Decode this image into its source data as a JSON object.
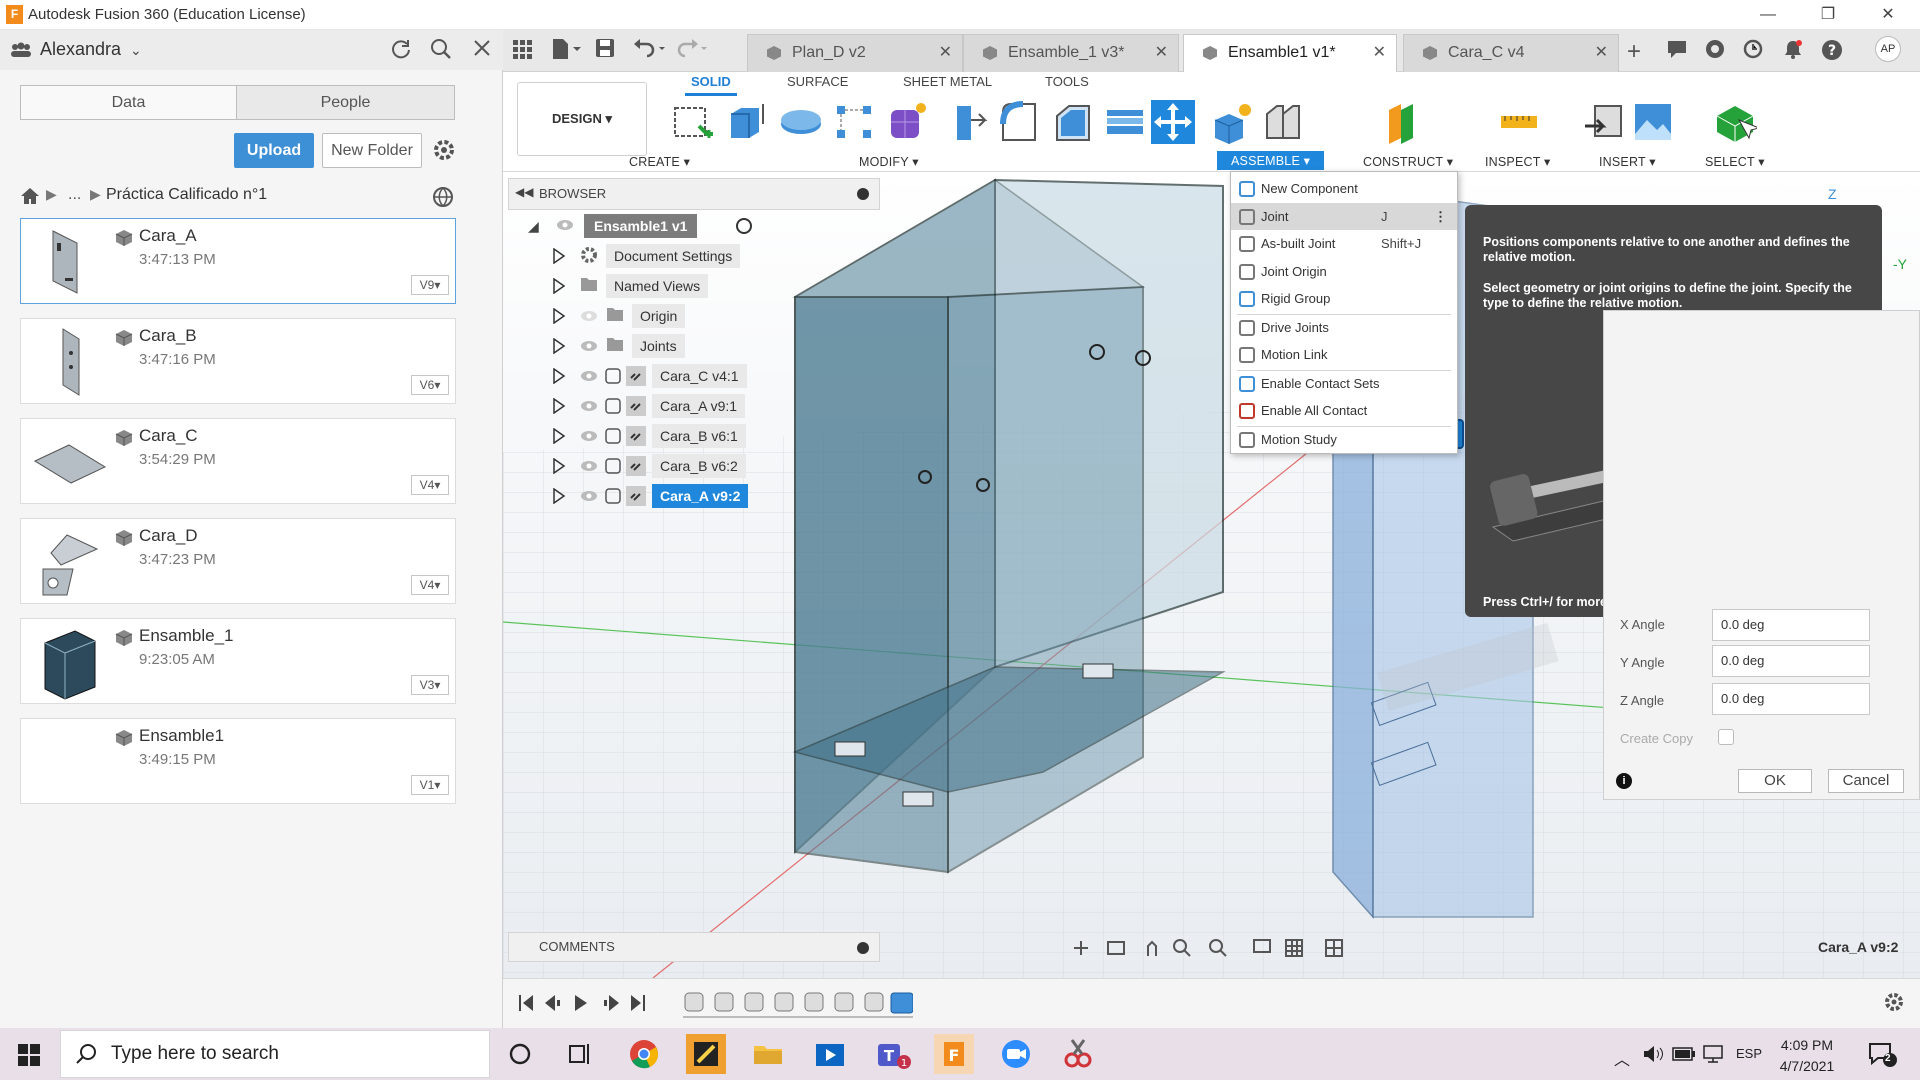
{
  "window": {
    "title": "Autodesk Fusion 360 (Education License)",
    "min": "—",
    "restore": "❐",
    "close": "✕"
  },
  "data_panel": {
    "user": "Alexandra",
    "tabs": [
      "Data",
      "People"
    ],
    "upload": "Upload",
    "new_folder": "New Folder",
    "breadcrumb_ellipsis": "...",
    "breadcrumb": "Práctica Calificado n°1",
    "files": [
      {
        "name": "Cara_A",
        "time": "3:47:13 PM",
        "version": "V9"
      },
      {
        "name": "Cara_B",
        "time": "3:47:16 PM",
        "version": "V6"
      },
      {
        "name": "Cara_C",
        "time": "3:54:29 PM",
        "version": "V4"
      },
      {
        "name": "Cara_D",
        "time": "3:47:23 PM",
        "version": "V4"
      },
      {
        "name": "Ensamble_1",
        "time": "9:23:05 AM",
        "version": "V3"
      },
      {
        "name": "Ensamble1",
        "time": "3:49:15 PM",
        "version": "V1"
      }
    ]
  },
  "tabs": [
    {
      "label": "Plan_D v2"
    },
    {
      "label": "Ensamble_1 v3*"
    },
    {
      "label": "Ensamble1 v1*"
    },
    {
      "label": "Cara_C v4"
    }
  ],
  "toolbar": {
    "workspace": "DESIGN ▾",
    "mode_tabs": [
      "SOLID",
      "SURFACE",
      "SHEET METAL",
      "TOOLS"
    ],
    "groups": {
      "create": "CREATE ▾",
      "modify": "MODIFY ▾",
      "assemble": "ASSEMBLE ▾",
      "construct": "CONSTRUCT ▾",
      "inspect": "INSPECT ▾",
      "insert": "INSERT ▾",
      "select": "SELECT ▾"
    }
  },
  "browser": {
    "title": "BROWSER",
    "root": "Ensamble1 v1",
    "items": [
      {
        "label": "Document Settings"
      },
      {
        "label": "Named Views"
      },
      {
        "label": "Origin"
      },
      {
        "label": "Joints"
      },
      {
        "label": "Cara_C v4:1"
      },
      {
        "label": "Cara_A v9:1"
      },
      {
        "label": "Cara_B v6:1"
      },
      {
        "label": "Cara_B v6:2"
      },
      {
        "label": "Cara_A v9:2"
      }
    ]
  },
  "assemble_menu": [
    {
      "label": "New Component",
      "shortcut": ""
    },
    {
      "label": "Joint",
      "shortcut": "J"
    },
    {
      "label": "As-built Joint",
      "shortcut": "Shift+J"
    },
    {
      "label": "Joint Origin",
      "shortcut": ""
    },
    {
      "label": "Rigid Group",
      "shortcut": ""
    },
    {
      "label": "Drive Joints",
      "shortcut": ""
    },
    {
      "label": "Motion Link",
      "shortcut": ""
    },
    {
      "label": "Enable Contact Sets",
      "shortcut": ""
    },
    {
      "label": "Enable All Contact",
      "shortcut": ""
    },
    {
      "label": "Motion Study",
      "shortcut": ""
    }
  ],
  "tooltip": {
    "line1": "Positions components relative to one another and defines the relative motion.",
    "line2": "Select geometry or joint origins to define the joint. Specify the type to define the relative motion.",
    "footer": "Press Ctrl+/ for more help."
  },
  "dialog": {
    "x_angle_label": "X Angle",
    "x_angle": "0.0 deg",
    "y_angle_label": "Y Angle",
    "y_angle": "0.0 deg",
    "z_angle_label": "Z Angle",
    "z_angle": "0.0 deg",
    "create_copy": "Create Copy",
    "ok": "OK",
    "cancel": "Cancel"
  },
  "viewcube": {
    "z": "Z",
    "y": "-Y"
  },
  "comments": "COMMENTS",
  "selection": "Cara_A v9:2",
  "taskbar": {
    "search_placeholder": "Type here to search",
    "lang": "ESP",
    "time": "4:09 PM",
    "date": "4/7/2021",
    "notifications": "2"
  },
  "colors": {
    "accent": "#1f88dc",
    "panel": "#f5f5f5",
    "tooltip": "#474747",
    "taskbar": "#e9dfe9",
    "part": "#5d8ea8"
  }
}
